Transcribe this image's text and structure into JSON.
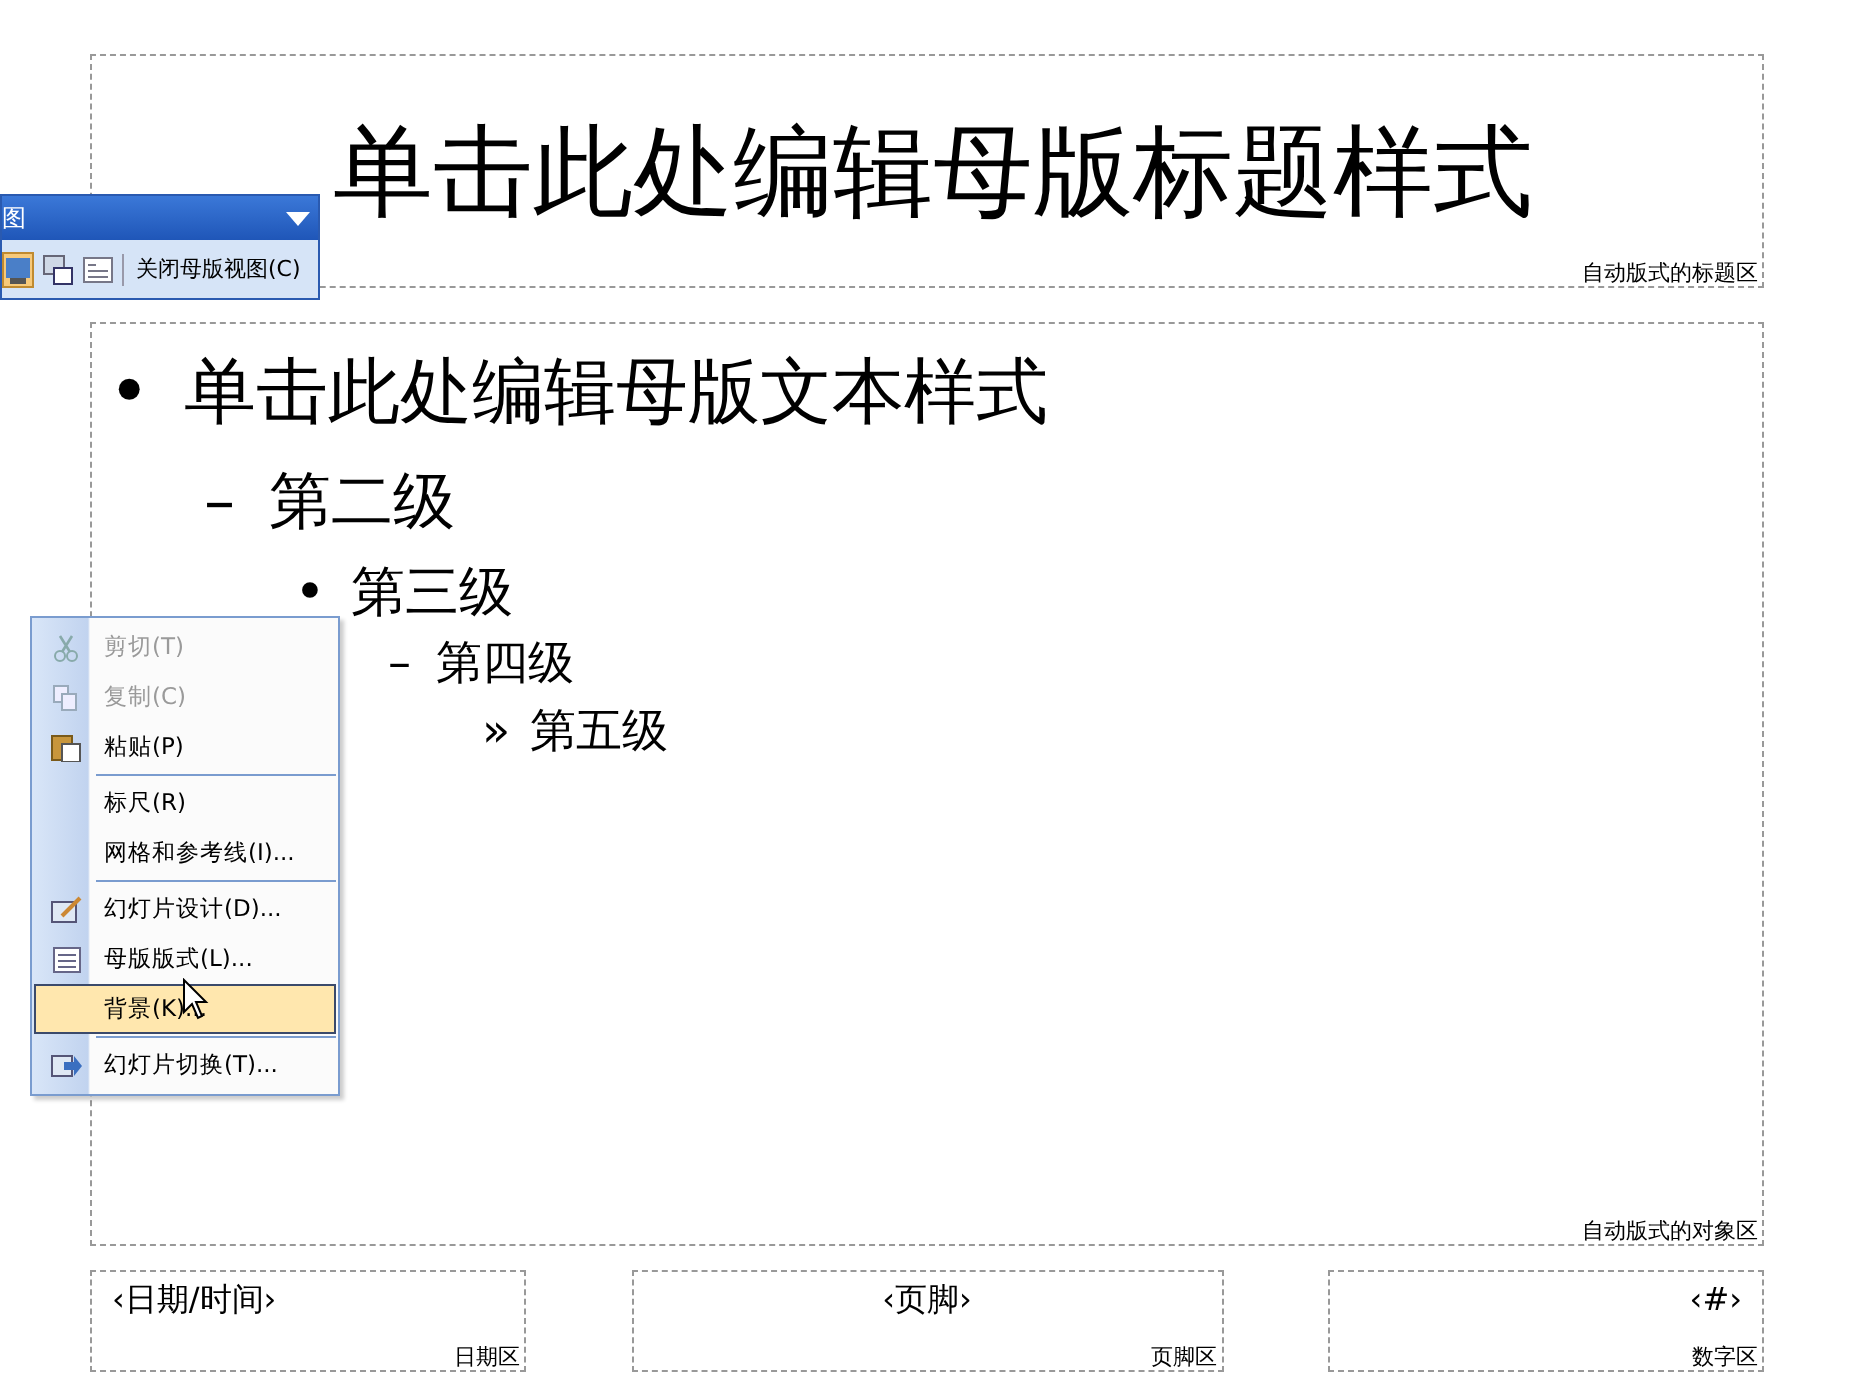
{
  "title_placeholder": {
    "text": "单击此处编辑母版标题样式",
    "label": "自动版式的标题区"
  },
  "body_placeholder": {
    "label": "自动版式的对象区",
    "items": [
      {
        "bullet": "•",
        "text": "单击此处编辑母版文本样式",
        "children": [
          {
            "bullet": "–",
            "text": "第二级",
            "children": [
              {
                "bullet": "•",
                "text": "第三级",
                "children": [
                  {
                    "bullet": "–",
                    "text": "第四级",
                    "children": [
                      {
                        "bullet": "»",
                        "text": "第五级"
                      }
                    ]
                  }
                ]
              }
            ]
          }
        ]
      }
    ]
  },
  "footer_placeholders": [
    {
      "text": "‹日期/时间›",
      "label": "日期区"
    },
    {
      "text": "‹页脚›",
      "label": "页脚区"
    },
    {
      "text": "‹#›",
      "label": "数字区"
    }
  ],
  "toolbar": {
    "title": "图",
    "close_button": "关闭母版视图(C)"
  },
  "context_menu": [
    {
      "kind": "item",
      "label": "剪切(T)",
      "disabled": true,
      "selected": false
    },
    {
      "kind": "item",
      "label": "复制(C)",
      "disabled": true,
      "selected": false
    },
    {
      "kind": "item",
      "label": "粘贴(P)",
      "disabled": false,
      "selected": false
    },
    {
      "kind": "separator"
    },
    {
      "kind": "item",
      "label": "标尺(R)",
      "disabled": false,
      "selected": false
    },
    {
      "kind": "item",
      "label": "网格和参考线(I)...",
      "disabled": false,
      "selected": false
    },
    {
      "kind": "separator"
    },
    {
      "kind": "item",
      "label": "幻灯片设计(D)...",
      "disabled": false,
      "selected": false
    },
    {
      "kind": "item",
      "label": "母版版式(L)...",
      "disabled": false,
      "selected": false
    },
    {
      "kind": "item",
      "label": "背景(K)...",
      "disabled": false,
      "selected": true
    },
    {
      "kind": "separator"
    },
    {
      "kind": "item",
      "label": "幻灯片切换(T)...",
      "disabled": false,
      "selected": false
    }
  ]
}
